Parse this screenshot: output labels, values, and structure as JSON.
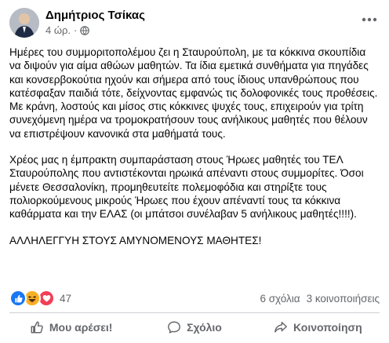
{
  "post": {
    "author_name": "Δημήτριος Τσίκας",
    "timestamp": "4 ώρ.",
    "audience_icon": "public-globe-icon",
    "more_icon": "more-options-icon",
    "paragraphs": [
      "Ημέρες του συμμοριτοπολέμου ζει η Σταυρούπολη, με τα κόκκινα σκουπίδια να διψούν για αίμα αθώων μαθητών. Τα ίδια εμετικά συνθήματα για πηγάδες και κονσερβοκούτια ηχούν και σήμερα από τους ίδιους υπανθρώπους που κατέσφαξαν παιδιά τότε, δείχνοντας εμφανώς τις δολοφονικές τους προθέσεις. Με κράνη, λοστούς και μίσος στις κόκκινες ψυχές τους, επιχειρούν για τρίτη συνεχόμενη ημέρα να τρομοκρατήσουν τους ανήλικους μαθητές που θέλουν να επιστρέψουν κανονικά στα μαθήματά τους.",
      "Χρέος μας η έμπρακτη συμπαράσταση στους Ήρωες μαθητές του ΤΕΛ Σταυρούπολης που αντιστέκονται ηρωικά απέναντι στους συμμορίτες. Όσοι μένετε Θεσσαλονίκη, προμηθευτείτε πολεμοφόδια και στηρίξτε τους πολιορκούμενους μικρούς Ήρωες που έχουν απέναντί τους τα κόκκινα καθάρματα και την ΕΛΑΣ (οι μπάτσοι συνέλαβαν 5 ανήλικους μαθητές!!!!).",
      "ΑΛΛΗΛΕΓΓΥΗ ΣΤΟΥΣ ΑΜΥΝΟΜΕΝΟΥΣ ΜΑΘΗΤΕΣ!"
    ]
  },
  "reactions": {
    "icons": [
      "like-reaction-icon",
      "haha-reaction-icon",
      "love-reaction-icon"
    ],
    "count": "47",
    "comments": "6 σχόλια",
    "shares": "3 κοινοποιήσεις"
  },
  "actions": {
    "like": "Μου αρέσει!",
    "comment": "Σχόλιο",
    "share": "Κοινοποίηση"
  },
  "colors": {
    "like_blue": "#1877f2",
    "haha_yellow": "#f7b125",
    "love_red": "#f33e58",
    "secondary_text": "#65676b"
  }
}
